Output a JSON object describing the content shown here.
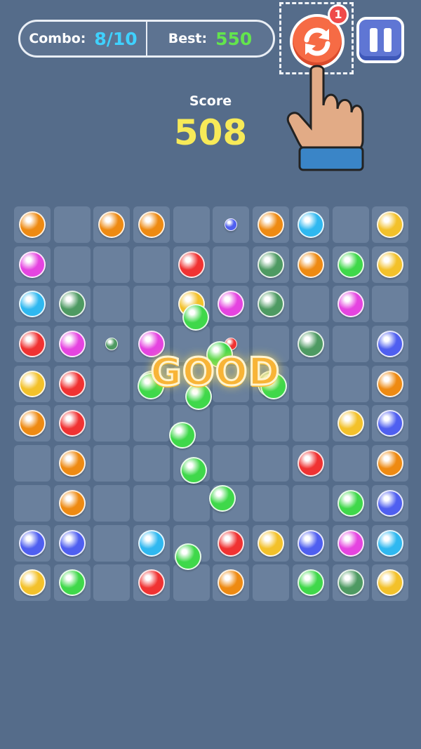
{
  "hud": {
    "combo_label": "Combo:",
    "combo_value": "8/10",
    "best_label": "Best:",
    "best_value": "550",
    "refresh_badge": "1",
    "refresh_icon": "refresh-icon",
    "pause_icon": "pause-icon"
  },
  "score": {
    "label": "Score",
    "value": "508"
  },
  "feedback_text": "GOOD",
  "colors": {
    "orange": "#ee8a12",
    "blue": "#2fb8f0",
    "yellow": "#f3c12a",
    "magenta": "#e544e0",
    "red": "#f03232",
    "darkgreen": "#4e9a62",
    "green": "#3fd84a",
    "indigo": "#4f5ff0",
    "background": "#556c8a",
    "cell": "#6a809d"
  },
  "grid": [
    [
      "orange",
      "",
      "orange",
      "orange",
      "",
      "indigo-small",
      "orange",
      "blue",
      "",
      "yellow"
    ],
    [
      "magenta",
      "",
      "",
      "",
      "red",
      "",
      "darkgreen",
      "orange",
      "green",
      "yellow"
    ],
    [
      "blue",
      "darkgreen",
      "",
      "",
      "yellow",
      "magenta",
      "darkgreen",
      "",
      "magenta",
      ""
    ],
    [
      "red",
      "magenta",
      "darkgreen-small",
      "magenta",
      "",
      "red-small",
      "",
      "darkgreen",
      "",
      "indigo"
    ],
    [
      "yellow",
      "red",
      "",
      "darkgreen",
      "",
      "",
      "darkgreen",
      "",
      "",
      "orange"
    ],
    [
      "orange",
      "red",
      "",
      "",
      "",
      "",
      "",
      "",
      "yellow",
      "indigo"
    ],
    [
      "",
      "orange",
      "",
      "",
      "",
      "",
      "",
      "red",
      "",
      "orange"
    ],
    [
      "",
      "orange",
      "",
      "",
      "",
      "",
      "",
      "",
      "green",
      "indigo"
    ],
    [
      "indigo",
      "indigo",
      "",
      "blue",
      "",
      "red",
      "yellow",
      "indigo",
      "magenta",
      "blue"
    ],
    [
      "yellow",
      "green",
      "",
      "red",
      "",
      "orange",
      "",
      "green",
      "darkgreen",
      "yellow"
    ]
  ],
  "flying_balls": [
    "green",
    "green",
    "green",
    "green",
    "green",
    "green",
    "green",
    "green",
    "green"
  ]
}
